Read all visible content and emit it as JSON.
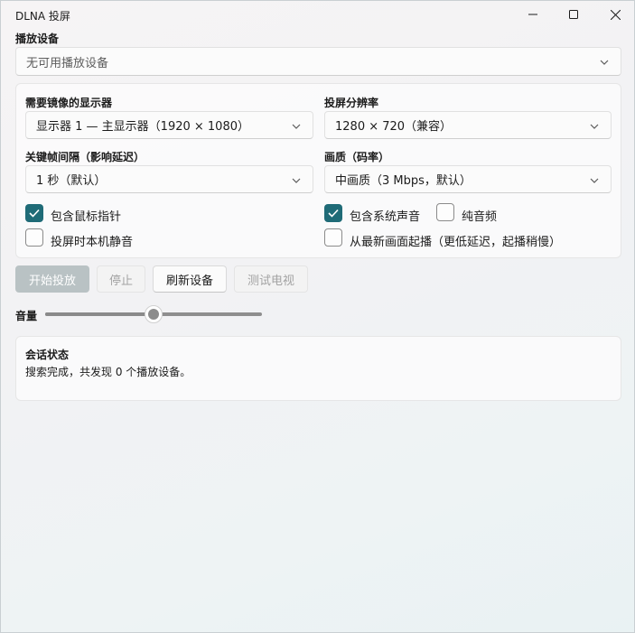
{
  "window": {
    "title": "DLNA 投屏",
    "controls": [
      "minimize-icon",
      "maximize-icon",
      "close-icon"
    ]
  },
  "device": {
    "label": "播放设备",
    "selected": "无可用播放设备"
  },
  "settings": {
    "display": {
      "label": "需要镜像的显示器",
      "selected": "显示器 1 — 主显示器（1920 × 1080）"
    },
    "resolution": {
      "label": "投屏分辨率",
      "selected": "1280 × 720（兼容）"
    },
    "keyframe": {
      "label": "关键帧间隔（影响延迟）",
      "selected": "1 秒（默认）"
    },
    "quality": {
      "label": "画质（码率）",
      "selected": "中画质（3 Mbps，默认）"
    },
    "checkboxes": {
      "include_cursor": {
        "label": "包含鼠标指针",
        "checked": true
      },
      "include_system_audio": {
        "label": "包含系统声音",
        "checked": true
      },
      "audio_only": {
        "label": "纯音频",
        "checked": false
      },
      "mute_local": {
        "label": "投屏时本机静音",
        "checked": false
      },
      "start_from_latest": {
        "label": "从最新画面起播（更低延迟，起播稍慢）",
        "checked": false
      }
    }
  },
  "actions": {
    "start": "开始投放",
    "stop": "停止",
    "refresh": "刷新设备",
    "test_tv": "测试电视"
  },
  "volume": {
    "label": "音量",
    "level_fraction": 0.5
  },
  "status": {
    "title": "会话状态",
    "message": "搜索完成，共发现 0 个播放设备。"
  },
  "colors": {
    "accent": "#1f6b77",
    "disabled_button": "#b9c2c4"
  }
}
